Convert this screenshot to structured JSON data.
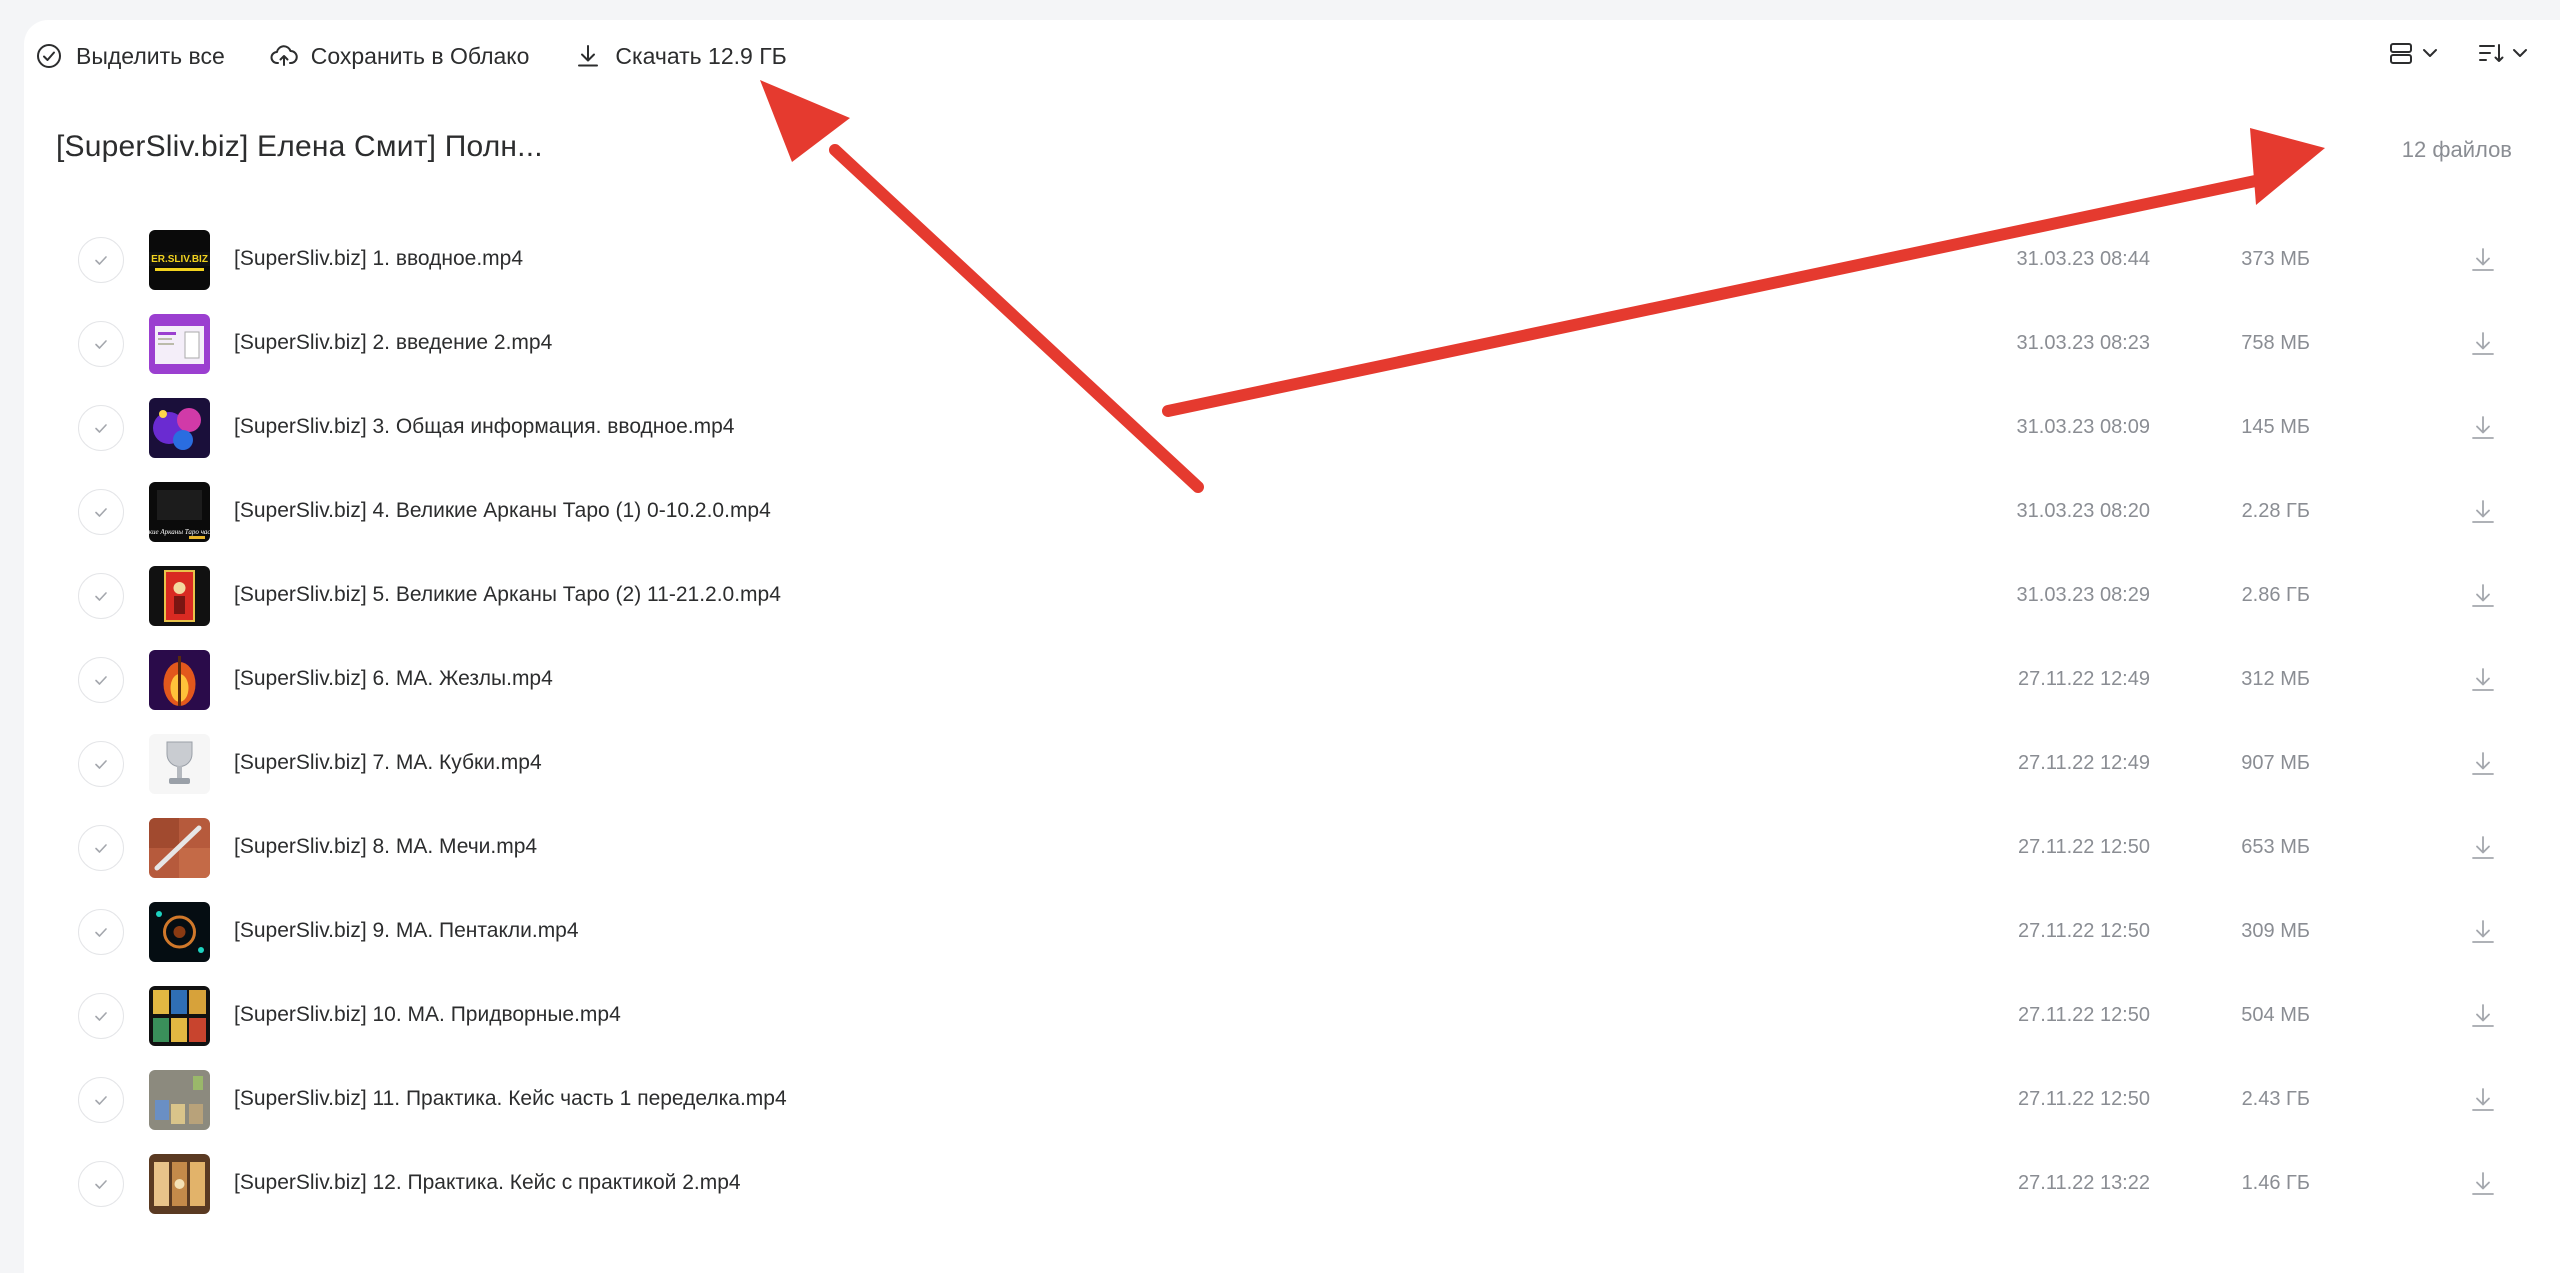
{
  "toolbar": {
    "select_all": "Выделить все",
    "save_to_cloud": "Сохранить в Облако",
    "download": "Скачать 12.9 ГБ"
  },
  "folder": {
    "title": "[SuperSliv.biz] Елена Смит] Полн...",
    "file_count": "12 файлов"
  },
  "files": [
    {
      "name": "[SuperSliv.biz] 1. вводное.mp4",
      "date": "31.03.23 08:44",
      "size": "373 МБ"
    },
    {
      "name": "[SuperSliv.biz] 2. введение 2.mp4",
      "date": "31.03.23 08:23",
      "size": "758 МБ"
    },
    {
      "name": "[SuperSliv.biz] 3. Общая информация. вводное.mp4",
      "date": "31.03.23 08:09",
      "size": "145 МБ"
    },
    {
      "name": "[SuperSliv.biz] 4. Великие Арканы Таро (1) 0-10.2.0.mp4",
      "date": "31.03.23 08:20",
      "size": "2.28 ГБ"
    },
    {
      "name": "[SuperSliv.biz] 5. Великие Арканы Таро (2) 11-21.2.0.mp4",
      "date": "31.03.23 08:29",
      "size": "2.86 ГБ"
    },
    {
      "name": "[SuperSliv.biz] 6. МА. Жезлы.mp4",
      "date": "27.11.22 12:49",
      "size": "312 МБ"
    },
    {
      "name": "[SuperSliv.biz] 7. МА. Кубки.mp4",
      "date": "27.11.22 12:49",
      "size": "907 МБ"
    },
    {
      "name": "[SuperSliv.biz] 8. МА. Мечи.mp4",
      "date": "27.11.22 12:50",
      "size": "653 МБ"
    },
    {
      "name": "[SuperSliv.biz] 9. МА. Пентакли.mp4",
      "date": "27.11.22 12:50",
      "size": "309 МБ"
    },
    {
      "name": "[SuperSliv.biz] 10. МА. Придворные.mp4",
      "date": "27.11.22 12:50",
      "size": "504 МБ"
    },
    {
      "name": "[SuperSliv.biz] 11. Практика. Кейс часть 1 переделка.mp4",
      "date": "27.11.22 12:50",
      "size": "2.43 ГБ"
    },
    {
      "name": "[SuperSliv.biz] 12. Практика. Кейс с практикой 2.mp4",
      "date": "27.11.22 13:22",
      "size": "1.46 ГБ"
    }
  ],
  "thumb_1_text": "ER.SLIV.BIZ",
  "thumb_4_text": "Великие Арканы Таро часть 1",
  "colors": {
    "annotation_arrow": "#e53a2f",
    "text_primary": "#2c2d2e",
    "text_secondary": "#8a8d93",
    "checkbox_border": "#e4e5e8",
    "page_background": "#f4f5f7",
    "panel_background": "#ffffff"
  },
  "icons": {
    "select_all": "check-circle-icon",
    "save_to_cloud": "cloud-upload-icon",
    "download": "download-icon",
    "view_mode": "list-view-icon",
    "sort": "sort-icon"
  }
}
